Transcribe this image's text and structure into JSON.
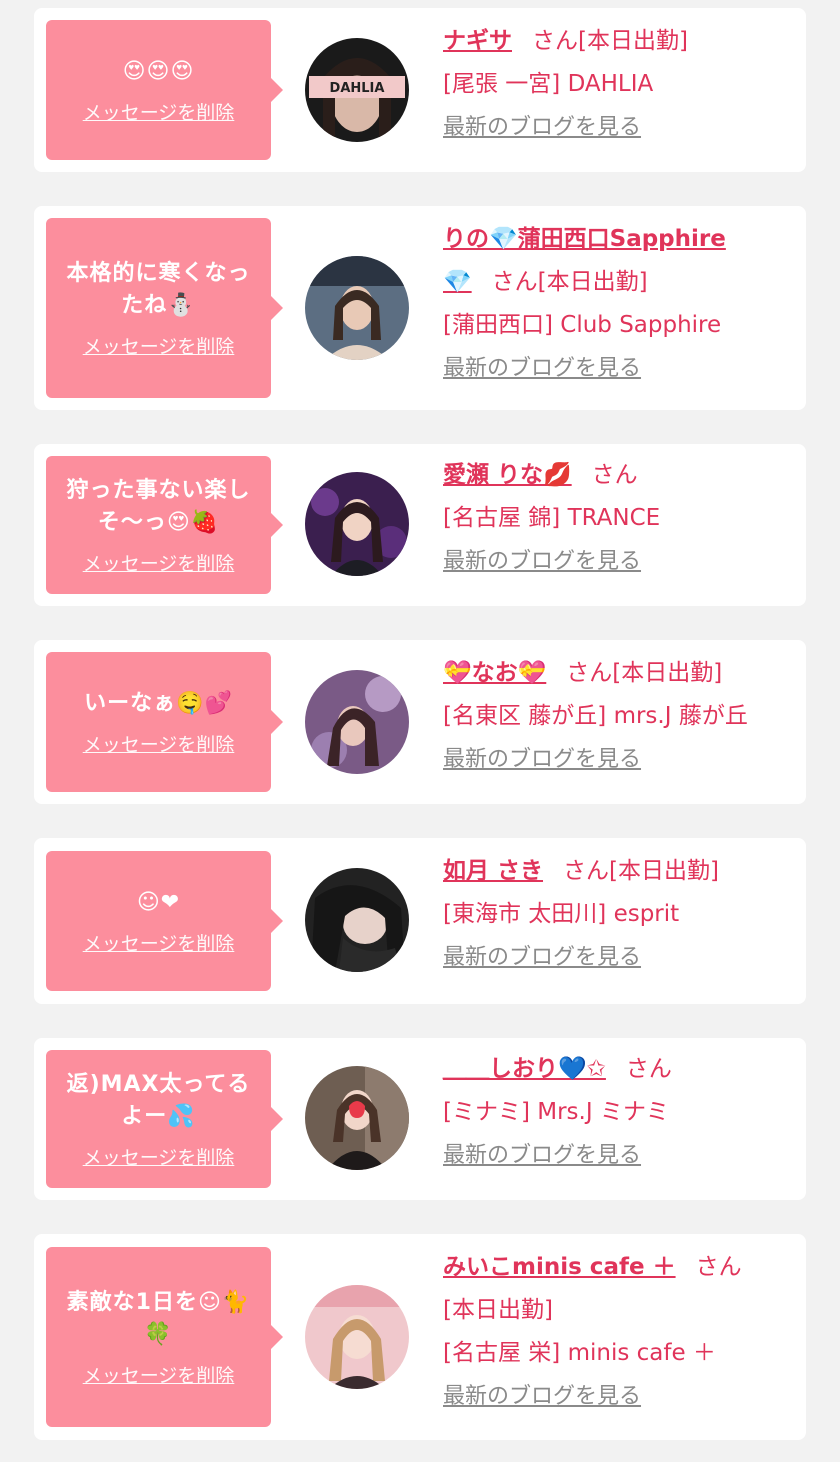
{
  "colors": {
    "bubble": "#fc8e9d",
    "accent": "#e0345a",
    "link_gray": "#8a8a8a",
    "background": "#f2f2f2"
  },
  "delete_label": "メッセージを削除",
  "blog_label": "最新のブログを見る",
  "cards": [
    {
      "message": "😍😍😍",
      "name": "ナギサ",
      "san": "さん",
      "status": "[本日出勤]",
      "shop": "[尾張 一宮] DAHLIA",
      "avatar_text": "DAHLIA"
    },
    {
      "message": "本格的に寒くなったね⛄",
      "name": "りの💎蒲田西口Sapphire💎",
      "name_line1": "りの💎蒲田西口Sapphire",
      "name_line2": "💎",
      "san": "さん",
      "status": "[本日出勤]",
      "shop": "[蒲田西口] Club Sapphire"
    },
    {
      "message": "狩った事ない楽しそ〜っ😍🍓",
      "name": "愛瀬 りな💋",
      "san": "さん",
      "status": "",
      "shop": "[名古屋 錦] TRANCE"
    },
    {
      "message": "いーなぁ🤤💕",
      "name": "💝なお💝",
      "san": "さん",
      "status": "[本日出勤]",
      "shop": "[名東区 藤が丘] mrs.J 藤が丘"
    },
    {
      "message": "☺❤",
      "name": "如月 さき",
      "san": "さん",
      "status": "[本日出勤]",
      "shop": "[東海市 太田川] esprit"
    },
    {
      "message": "返)MAX太ってるよー💦",
      "name": "＿＿しおり💙✩",
      "san": "さん",
      "status": "",
      "shop": "[ミナミ] Mrs.J ミナミ"
    },
    {
      "message": "素敵な1日を☺🐈🍀",
      "name": "みいこminis cafe ＋",
      "san": "さん",
      "status": "[本日出勤]",
      "shop": "[名古屋 栄] minis cafe ＋"
    }
  ]
}
